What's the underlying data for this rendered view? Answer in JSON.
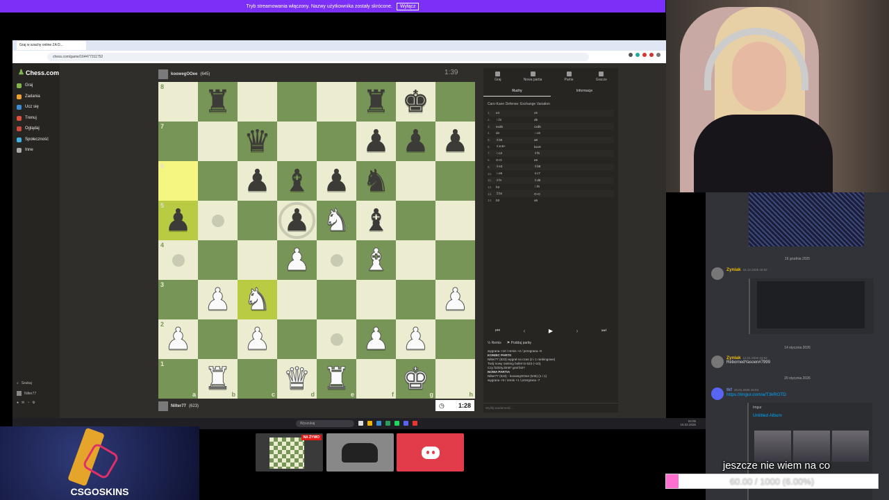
{
  "notice": {
    "text": "Tryb streamowania włączony. Nazwy użytkownika zostały skrócone.",
    "button": "Wyłącz"
  },
  "browser": {
    "tab_title": "Graj w szachy online ZA D...",
    "url": "chess.com/game/164477311752"
  },
  "sidebar": {
    "logo": "Chess.com",
    "items": [
      {
        "label": "Graj",
        "color": "#81b64c"
      },
      {
        "label": "Zadania",
        "color": "#f0a030"
      },
      {
        "label": "Ucz się",
        "color": "#3c8fd6"
      },
      {
        "label": "Trenuj",
        "color": "#e0503a"
      },
      {
        "label": "Oglądaj",
        "color": "#d04a3a"
      },
      {
        "label": "Społeczność",
        "color": "#3cb0e0"
      },
      {
        "label": "Inne",
        "color": "#aaaaaa"
      }
    ],
    "bottom": {
      "search": "Szukaj",
      "user": "Nilter77"
    }
  },
  "players": {
    "top": {
      "name": "koowegOOee",
      "rating": "(645)",
      "clock": "1:39"
    },
    "bottom": {
      "name": "Nilter77",
      "rating": "(623)",
      "clock": "1:28"
    }
  },
  "board": {
    "files": [
      "a",
      "b",
      "c",
      "d",
      "e",
      "f",
      "g",
      "h"
    ],
    "ranks": [
      "8",
      "7",
      "6",
      "5",
      "4",
      "3",
      "2",
      "1"
    ],
    "rows": [
      [
        "",
        "bR",
        "",
        "",
        "",
        "bR",
        "bK",
        ""
      ],
      [
        "",
        "",
        "bQ",
        "",
        "",
        "bP",
        "bP",
        "bP"
      ],
      [
        "hl",
        "",
        "bP",
        "bB",
        "bP",
        "bN",
        "",
        ""
      ],
      [
        "bP",
        "dot",
        "",
        "bP",
        "wN",
        "bB",
        "",
        ""
      ],
      [
        "dot",
        "",
        "",
        "wP",
        "dot",
        "wB",
        "",
        ""
      ],
      [
        "",
        "wP",
        "wN",
        "",
        "",
        "",
        "",
        "wP"
      ],
      [
        "wP",
        "",
        "wP",
        "",
        "dot",
        "wP",
        "wP",
        ""
      ],
      [
        "",
        "wR",
        "",
        "wQ",
        "wR",
        "",
        "wK",
        ""
      ]
    ],
    "highlights": [
      "a6",
      "a5",
      "c3"
    ],
    "ring": "d5"
  },
  "panel": {
    "tabs": [
      "Graj",
      "Nowa partia",
      "Partie",
      "Gracze"
    ],
    "subtabs": [
      "Ruchy",
      "Informacje"
    ],
    "opening": "Caro-Kann Defense: Exchange Variation",
    "moves": [
      {
        "n": "1.",
        "w": "e4",
        "b": "c6"
      },
      {
        "n": "2.",
        "w": "♘f3",
        "b": "d5"
      },
      {
        "n": "3.",
        "w": "exd5",
        "b": "cxd5"
      },
      {
        "n": "4.",
        "w": "d4",
        "b": "♘c6"
      },
      {
        "n": "5.",
        "w": "♗b5",
        "b": "a6"
      },
      {
        "n": "6.",
        "w": "♗xc6+",
        "b": "bxc6"
      },
      {
        "n": "7.",
        "w": "♘c3",
        "b": "♗f5"
      },
      {
        "n": "8.",
        "w": "O-O",
        "b": "e6"
      },
      {
        "n": "9.",
        "w": "♗e3",
        "b": "♗b8"
      },
      {
        "n": "10.",
        "w": "♘e5",
        "b": "♕c7"
      },
      {
        "n": "11.",
        "w": "♗f4",
        "b": "♗d6"
      },
      {
        "n": "12.",
        "w": "h3",
        "b": "♘f6"
      },
      {
        "n": "13.",
        "w": "♖b1",
        "b": "O-O"
      },
      {
        "n": "14.",
        "w": "b3",
        "b": "a5"
      }
    ],
    "nav": [
      "⏮",
      "‹",
      "▶",
      "›",
      "⏭"
    ],
    "actions": [
      "Remis",
      "Poddaj partię"
    ],
    "chat": [
      "wygrana +10 / remis +2 / przegrana -8",
      "KONIEC PARTII",
      "Nilter77 (623) wygrał na czas (2 i 1 rankingowe)",
      "Twój nowy ranking bullet to 623 (+10).",
      "Czy f1DirtyJim87 grał fair?",
      "NOWA PARTIA",
      "Nilter77 (623) - koowegOOee (645) (1 i 1)",
      "wygrana +9 / remis +1 / przegrana -7"
    ],
    "chat_placeholder": "Wyślij wiadomość..."
  },
  "taskbar": {
    "search": "Wyszukaj",
    "time": "04:05",
    "date": "15.02.2026"
  },
  "discord": {
    "sep1": "16 grudnia 2025",
    "msg1": {
      "name": "Zyniak",
      "time": "16.12.2025 18:52"
    },
    "sep2": "14 stycznia 2026",
    "msg2": {
      "name": "Zyniak",
      "time": "14.01.2026 23:53",
      "text": "RebornedYasoen#7999"
    },
    "sep3": "20 stycznia 2026",
    "msg3": {
      "name": "tkf",
      "time": "20.01.2026 15:04",
      "link": "https://imgur.com/a/T3kROTD"
    },
    "embed": {
      "site": "Imgur",
      "title": "Untitled Album"
    }
  },
  "goal": {
    "text": "jeszcze nie wiem na co",
    "label": "60.00 / 1000 (6.00%)",
    "fraction": 0.06
  },
  "overlay": {
    "brand": "CSGOSKINS",
    "live_badge": "NA ŻYWO"
  }
}
